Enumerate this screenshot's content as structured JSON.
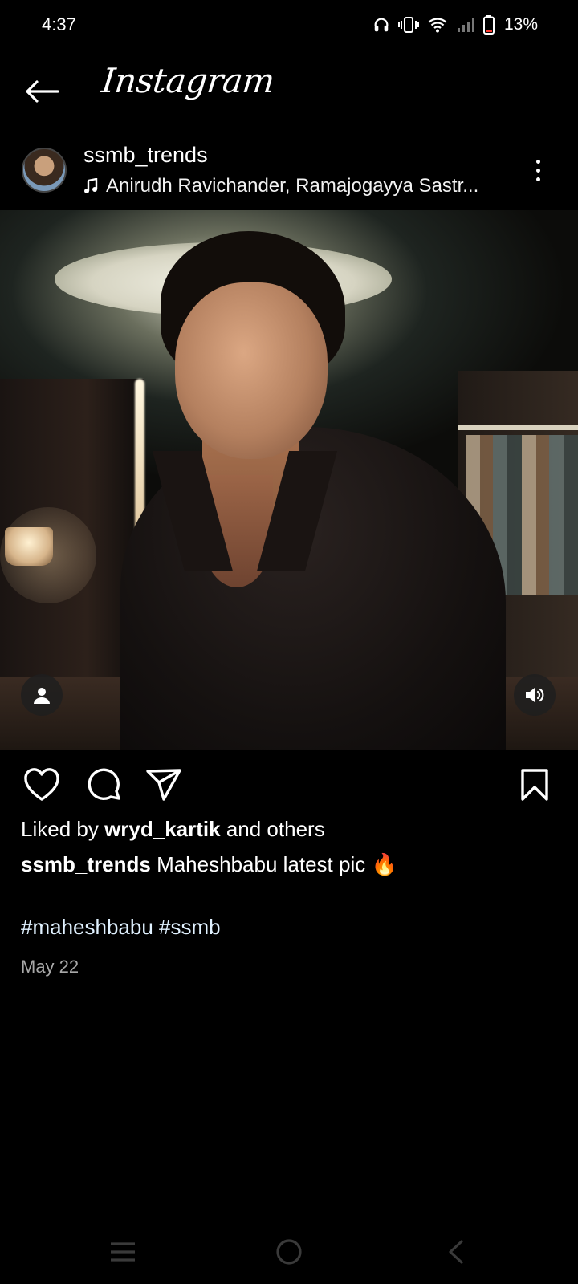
{
  "status_bar": {
    "time": "4:37",
    "battery": "13%",
    "icons": [
      "headphones-icon",
      "vibrate-icon",
      "wifi-icon",
      "signal-icon",
      "battery-icon"
    ]
  },
  "header": {
    "app_title": "Instagram"
  },
  "post": {
    "username": "ssmb_trends",
    "audio": "Anirudh Ravichander, Ramajogayya Sastr...",
    "liked_by_prefix": "Liked by ",
    "liked_by_user": "wryd_kartik",
    "liked_by_suffix": " and others",
    "caption_user": "ssmb_trends",
    "caption_text": " Maheshbabu latest pic 🔥",
    "hashtags": [
      "#maheshbabu",
      "#ssmb"
    ],
    "date": "May 22"
  },
  "colors": {
    "background": "#000000",
    "text": "#ffffff",
    "muted": "#a8a8a8",
    "hashtag": "#e0f1ff"
  }
}
